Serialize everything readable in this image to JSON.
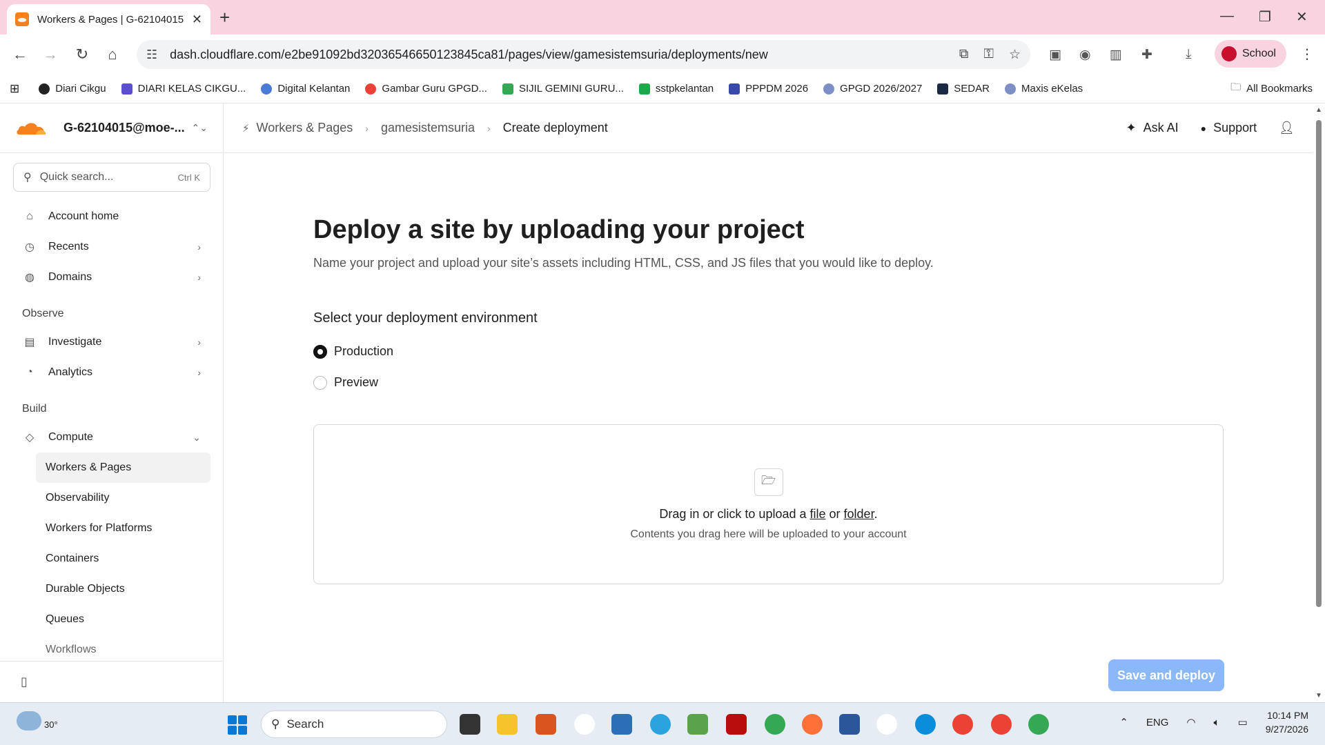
{
  "browser": {
    "tab_title": "Workers & Pages | G-62104015",
    "url": "dash.cloudflare.com/e2be91092bd32036546650123845ca81/pages/view/gamesistemsuria/deployments/new",
    "profile_label": "School",
    "bookmarks": [
      {
        "label": "Diari Cikgu",
        "color": "#222222"
      },
      {
        "label": "DIARI KELAS CIKGU...",
        "color": "#5b4fcf"
      },
      {
        "label": "Digital Kelantan",
        "color": "#4a7bd6"
      },
      {
        "label": "Gambar Guru GPGD...",
        "color": "#ea4335"
      },
      {
        "label": "SIJIL GEMINI GURU...",
        "color": "#34a853"
      },
      {
        "label": "sstpkelantan",
        "color": "#1fa84a"
      },
      {
        "label": "PPPDM 2026",
        "color": "#3949ab"
      },
      {
        "label": "GPGD 2026/2027",
        "color": "#7e8fc8"
      },
      {
        "label": "SEDAR",
        "color": "#1b2a44"
      },
      {
        "label": "Maxis eKelas",
        "color": "#7e8fc8"
      }
    ],
    "all_bookmarks": "All Bookmarks"
  },
  "sidebar": {
    "account_name": "G-62104015@moe-...",
    "search_placeholder": "Quick search...",
    "search_shortcut": "Ctrl K",
    "top_items": [
      {
        "label": "Account home",
        "icon": "home-icon"
      },
      {
        "label": "Recents",
        "icon": "clock-icon"
      },
      {
        "label": "Domains",
        "icon": "globe-icon"
      }
    ],
    "observe_label": "Observe",
    "observe_items": [
      {
        "label": "Investigate"
      },
      {
        "label": "Analytics"
      }
    ],
    "build_label": "Build",
    "compute_label": "Compute",
    "compute_items": [
      {
        "label": "Workers & Pages",
        "active": true
      },
      {
        "label": "Observability"
      },
      {
        "label": "Workers for Platforms"
      },
      {
        "label": "Containers"
      },
      {
        "label": "Durable Objects"
      },
      {
        "label": "Queues"
      },
      {
        "label": "Workflows"
      }
    ]
  },
  "topbar": {
    "crumbs": [
      "Workers & Pages",
      "gamesistemsuria",
      "Create deployment"
    ],
    "ask_ai": "Ask AI",
    "support": "Support"
  },
  "main": {
    "title": "Deploy a site by uploading your project",
    "description": "Name your project and upload your site’s assets including HTML, CSS, and JS files that you would like to deploy.",
    "env_label": "Select your deployment environment",
    "env_options": [
      {
        "label": "Production",
        "selected": true
      },
      {
        "label": "Preview",
        "selected": false
      }
    ],
    "dropzone": {
      "prefix": "Drag in or click to upload a ",
      "file_link": "file",
      "or_text": " or ",
      "folder_link": "folder",
      "suffix": ".",
      "subtext": "Contents you drag here will be uploaded to your account"
    },
    "save_button": "Save and deploy"
  },
  "taskbar": {
    "temperature": "30°",
    "search_label": "Search",
    "language": "ENG",
    "time": "10:14 PM",
    "date": "9/27/2026"
  }
}
